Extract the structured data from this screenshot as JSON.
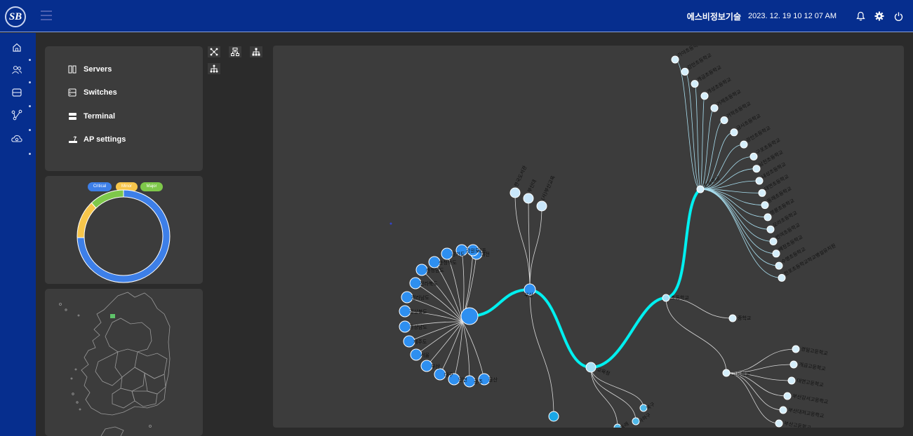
{
  "header": {
    "logo_text": "SB",
    "company": "에스비정보기술",
    "datetime": "2023. 12. 19   10 12 07 AM",
    "icons": [
      "bell-icon",
      "gear-icon",
      "power-icon"
    ]
  },
  "sidebar": {
    "items": [
      "home-icon",
      "users-icon",
      "server-icon",
      "network-icon",
      "cloud-icon"
    ]
  },
  "menu": {
    "items": [
      {
        "label": "Servers",
        "icon": "servers-icon"
      },
      {
        "label": "Switches",
        "icon": "switch-icon"
      },
      {
        "label": "Terminal",
        "icon": "terminal-icon"
      },
      {
        "label": "AP settings",
        "icon": "ap-icon"
      }
    ]
  },
  "donut": {
    "legend": [
      {
        "label": "Critical",
        "color": "#3d7fe8"
      },
      {
        "label": "Minor",
        "color": "#f7c64b"
      },
      {
        "label": "Major",
        "color": "#7ec84a"
      }
    ]
  },
  "graph": {
    "branch_color": "#00f0f0",
    "cluster_a": [
      "경기도",
      "강원도",
      "충청북도",
      "충청남도",
      "전라북도",
      "전라남도",
      "경상북도",
      "경상남도",
      "제주도",
      "서울",
      "부산",
      "대구",
      "인천",
      "광주",
      "대전",
      "울산",
      "세종"
    ],
    "cluster_b": [
      "한국도서관",
      "부산대",
      "(사)부산교육"
    ],
    "root_label": "부산",
    "mid_label": "교육청",
    "cluster_c": [
      "가야초등학교",
      "감만초등학교",
      "개금초등학교",
      "개성초등학교",
      "거제초등학교",
      "거학초등학교",
      "금사초등학교",
      "광안초등학교",
      "구포초등학교",
      "남천초등학교",
      "내성초등학교",
      "대연초등학교",
      "동래초등학교",
      "명륜초등학교",
      "모라초등학교",
      "반여초등학교",
      "배정초등학교",
      "수영초등학교",
      "전포초등학교학교병설유치원"
    ],
    "hub_c_label": "초등학교",
    "hub_d_label": "중학교",
    "hub_e_label": "고등학교",
    "cluster_e": [
      "경일고등학교",
      "개금고등학교",
      "대연고등학교",
      "부산강서고등학교",
      "부산대저고등학교",
      "부산고등학교"
    ],
    "bottom_labels": [
      "북구",
      "사하구",
      "동래"
    ]
  }
}
